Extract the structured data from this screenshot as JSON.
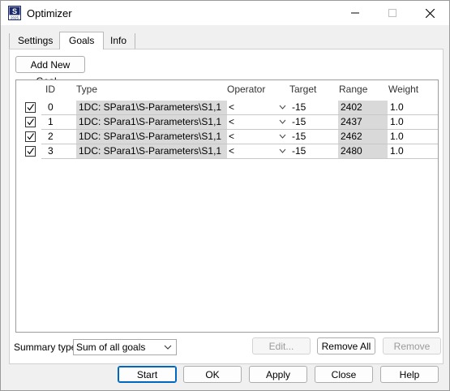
{
  "window": {
    "title": "Optimizer"
  },
  "tabs": [
    "Settings",
    "Goals",
    "Info"
  ],
  "add_goal_label": "Add New Goal...",
  "columns": {
    "id": "ID",
    "type": "Type",
    "operator": "Operator",
    "target": "Target",
    "range": "Range",
    "weight": "Weight"
  },
  "goals": [
    {
      "checked": true,
      "id": "0",
      "type": "1DC: SPara1\\S-Parameters\\S1,1",
      "operator": "<",
      "target": "-15",
      "range": "2402",
      "weight": "1.0"
    },
    {
      "checked": true,
      "id": "1",
      "type": "1DC: SPara1\\S-Parameters\\S1,1",
      "operator": "<",
      "target": "-15",
      "range": "2437",
      "weight": "1.0"
    },
    {
      "checked": true,
      "id": "2",
      "type": "1DC: SPara1\\S-Parameters\\S1,1",
      "operator": "<",
      "target": "-15",
      "range": "2462",
      "weight": "1.0"
    },
    {
      "checked": true,
      "id": "3",
      "type": "1DC: SPara1\\S-Parameters\\S1,1",
      "operator": "<",
      "target": "-15",
      "range": "2480",
      "weight": "1.0"
    }
  ],
  "summary": {
    "label": "Summary type:",
    "value": "Sum of all goals"
  },
  "panel_buttons": {
    "edit": "Edit...",
    "remove_all": "Remove All",
    "remove": "Remove"
  },
  "footer_buttons": {
    "start": "Start",
    "ok": "OK",
    "apply": "Apply",
    "close": "Close",
    "help": "Help"
  },
  "app_icon": {
    "name": "optimizer-app-icon",
    "text_top": "S",
    "text_bottom": "2025"
  }
}
